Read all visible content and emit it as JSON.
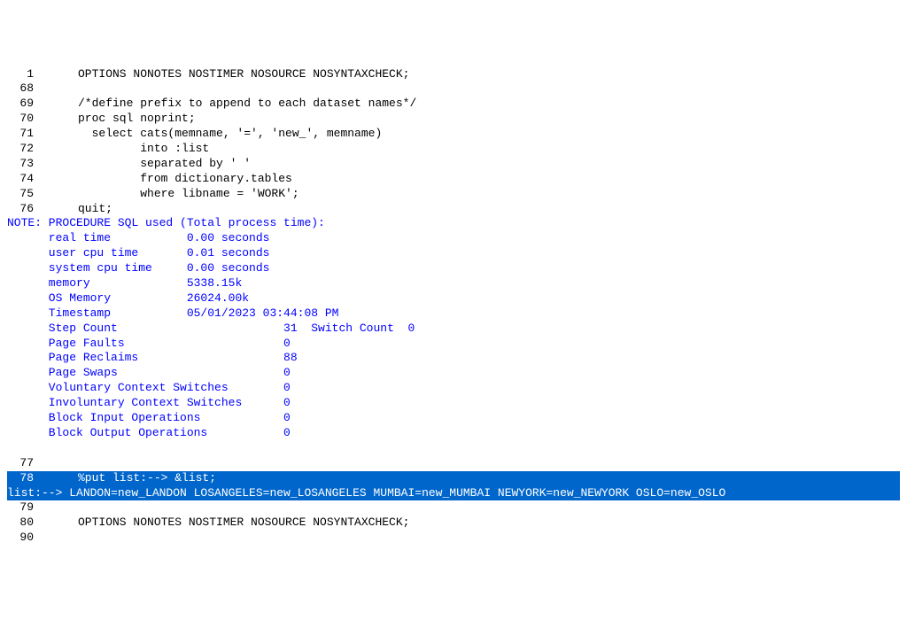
{
  "log": {
    "lines": [
      {
        "num": "1",
        "content": "OPTIONS NONOTES NOSTIMER NOSOURCE NOSYNTAXCHECK;",
        "class": "",
        "highlight": false
      },
      {
        "num": "68",
        "content": "",
        "class": "",
        "highlight": false
      },
      {
        "num": "69",
        "content": "/*define prefix to append to each dataset names*/",
        "class": "",
        "highlight": false
      },
      {
        "num": "70",
        "content": "proc sql noprint;",
        "class": "",
        "highlight": false
      },
      {
        "num": "71",
        "content": "  select cats(memname, '=', 'new_', memname)",
        "class": "",
        "highlight": false
      },
      {
        "num": "72",
        "content": "         into :list",
        "class": "",
        "highlight": false
      },
      {
        "num": "73",
        "content": "         separated by ' '",
        "class": "",
        "highlight": false
      },
      {
        "num": "74",
        "content": "         from dictionary.tables",
        "class": "",
        "highlight": false
      },
      {
        "num": "75",
        "content": "         where libname = 'WORK';",
        "class": "",
        "highlight": false
      },
      {
        "num": "76",
        "content": "quit;",
        "class": "",
        "highlight": false
      }
    ],
    "note_line": "NOTE: PROCEDURE SQL used (Total process time):",
    "stats": [
      "      real time           0.00 seconds",
      "      user cpu time       0.01 seconds",
      "      system cpu time     0.00 seconds",
      "      memory              5338.15k",
      "      OS Memory           26024.00k",
      "      Timestamp           05/01/2023 03:44:08 PM",
      "      Step Count                        31  Switch Count  0",
      "      Page Faults                       0",
      "      Page Reclaims                     88",
      "      Page Swaps                        0",
      "      Voluntary Context Switches        0",
      "      Involuntary Context Switches      0",
      "      Block Input Operations            0",
      "      Block Output Operations           0"
    ],
    "blank": " ",
    "tail": [
      {
        "num": "77",
        "content": "",
        "class": "",
        "highlight": false
      },
      {
        "num": "78",
        "content": "%put list:--> &list;",
        "class": "",
        "highlight": true
      },
      {
        "full": true,
        "content": "list:--> LANDON=new_LANDON LOSANGELES=new_LOSANGELES MUMBAI=new_MUMBAI NEWYORK=new_NEWYORK OSLO=new_OSLO",
        "highlight": true
      },
      {
        "num": "79",
        "content": "",
        "class": "",
        "highlight": false
      },
      {
        "num": "80",
        "content": "OPTIONS NONOTES NOSTIMER NOSOURCE NOSYNTAXCHECK;",
        "class": "",
        "highlight": false
      },
      {
        "num": "90",
        "content": "",
        "class": "",
        "highlight": false
      }
    ]
  }
}
